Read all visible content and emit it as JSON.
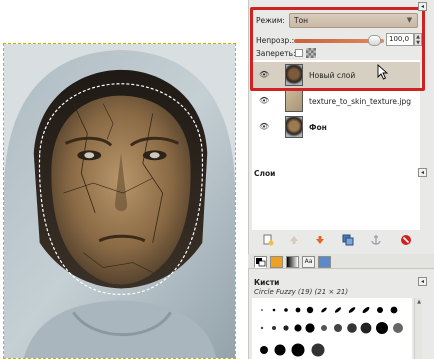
{
  "layers_panel": {
    "mode_label": "Режим:",
    "mode_value": "Тон",
    "opacity_label": "Непрозр.:",
    "opacity_value": "100,0",
    "lock_label": "Запереть:",
    "title": "Слои",
    "layers": [
      {
        "name": "Новый слой",
        "visible": true,
        "selected": true,
        "bold": false
      },
      {
        "name": "texture_to_skin_texture.jpg",
        "visible": true,
        "selected": false,
        "bold": false
      },
      {
        "name": "Фон",
        "visible": true,
        "selected": false,
        "bold": true
      }
    ]
  },
  "brushes_panel": {
    "title": "Кисти",
    "selected_brush": "Circle Fuzzy (19) (21 × 21)"
  },
  "colors": {
    "accent_highlight": "#cf2222",
    "selected_layer_bg": "#d8cfc3",
    "selection_marquee": "#b8b800"
  }
}
